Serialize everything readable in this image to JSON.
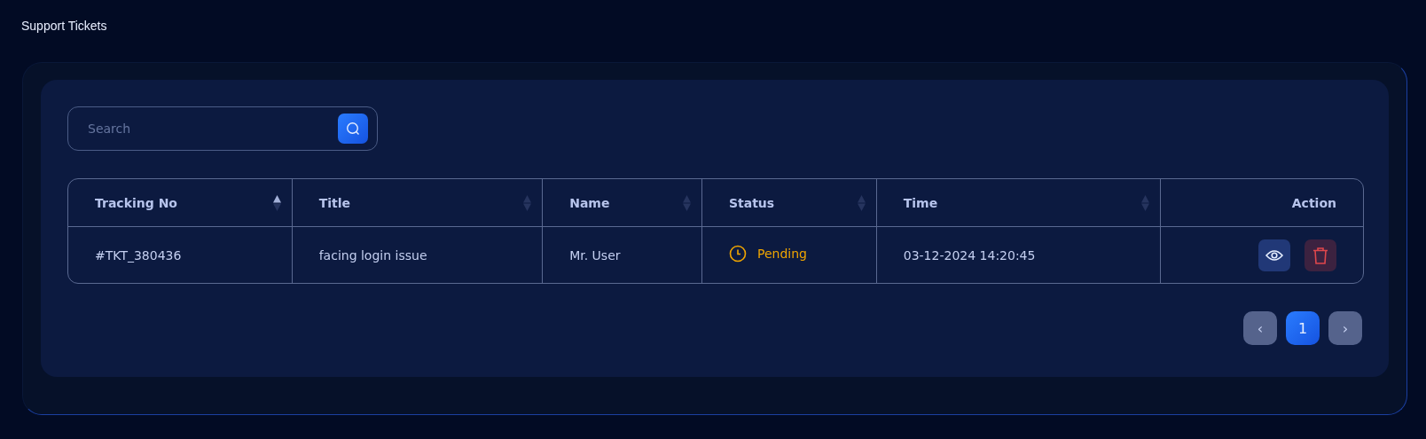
{
  "page_title": "Support Tickets",
  "search": {
    "placeholder": "Search"
  },
  "table": {
    "columns": [
      {
        "label": "Tracking No",
        "sortable": true,
        "sorted_ascending": true
      },
      {
        "label": "Title",
        "sortable": true,
        "sorted_ascending": false
      },
      {
        "label": "Name",
        "sortable": true,
        "sorted_ascending": false
      },
      {
        "label": "Status",
        "sortable": true,
        "sorted_ascending": false
      },
      {
        "label": "Time",
        "sortable": true,
        "sorted_ascending": false
      },
      {
        "label": "Action",
        "sortable": false
      }
    ],
    "rows": [
      {
        "tracking_no": "#TKT_380436",
        "title": "facing login issue",
        "name": "Mr. User",
        "status": {
          "label": "Pending",
          "kind": "pending"
        },
        "time": "03-12-2024 14:20:45"
      }
    ]
  },
  "pagination": {
    "prev": "‹",
    "next": "›",
    "pages": [
      {
        "label": "1",
        "selected": true
      }
    ]
  }
}
